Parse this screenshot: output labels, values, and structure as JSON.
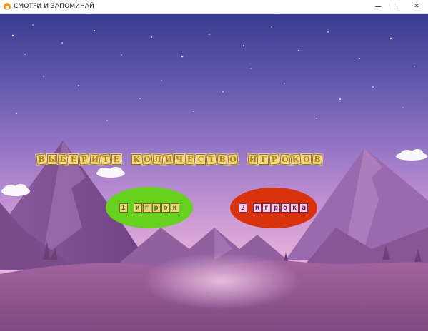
{
  "window": {
    "title": "СМОТРИ И ЗАПОМИНАЙ",
    "icon": "app-logo-icon",
    "controls": {
      "minimize": "minimize-icon",
      "maximize": "maximize-icon",
      "close": "✕"
    }
  },
  "menu": {
    "heading_words": [
      "ВЫБЕРИТЕ",
      "КОЛИЧЕСТВО",
      "ИГРОКОВ"
    ],
    "buttons": [
      {
        "label": "1 игрок",
        "color": "#66d11e"
      },
      {
        "label": "2 игрока",
        "color": "#d8320c"
      }
    ]
  },
  "colors": {
    "sky_top": "#3a3b8e",
    "sky_bottom": "#e6b3dc",
    "letter_tile": "#f5d878"
  }
}
